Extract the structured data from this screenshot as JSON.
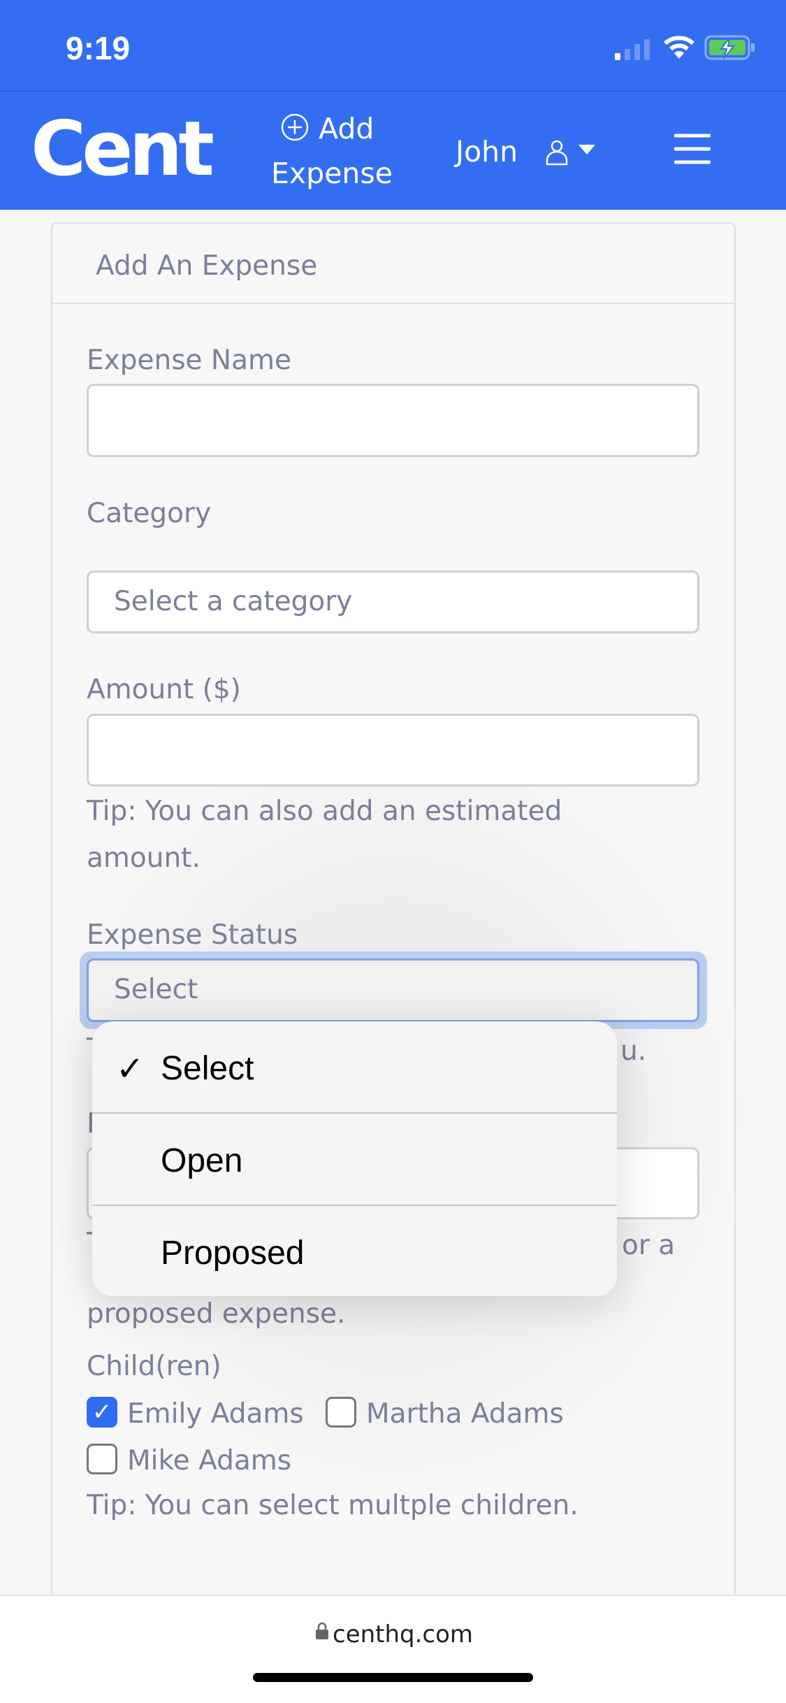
{
  "status_bar": {
    "time": "9:19",
    "icons": [
      "signal-icon",
      "wifi-icon",
      "battery-charging-icon"
    ]
  },
  "nav": {
    "logo": "Cent",
    "add_expense_line1": "Add",
    "add_expense_line2": "Expense",
    "user": "John",
    "brand_color": "#336ef2"
  },
  "card": {
    "title": "Add An Expense"
  },
  "form": {
    "expense_name_label": "Expense Name",
    "expense_name_value": "",
    "category_label": "Category",
    "category_value": "Select a category",
    "amount_label": "Amount ($)",
    "amount_value": "",
    "amount_tip": "Tip: You can also add an estimated",
    "amount_tip_2": "amount.",
    "status_label": "Expense Status",
    "status_value": "Select",
    "hidden_tip_start": "T",
    "hidden_tip_end": "u.",
    "hidden_label_start": "E",
    "hidden_tip2_start": "T",
    "hidden_tip2_end": "or a",
    "hidden_tip2_line2": "proposed expense.",
    "children_label": "Child(ren)",
    "children": [
      {
        "name": "Emily Adams",
        "checked": true
      },
      {
        "name": "Martha Adams",
        "checked": false
      },
      {
        "name": "Mike Adams",
        "checked": false
      }
    ],
    "children_tip": "Tip: You can select multple children."
  },
  "dropdown": {
    "options": [
      {
        "label": "Select",
        "selected": true
      },
      {
        "label": "Open",
        "selected": false
      },
      {
        "label": "Proposed",
        "selected": false
      }
    ]
  },
  "browser": {
    "url": "centhq.com"
  }
}
